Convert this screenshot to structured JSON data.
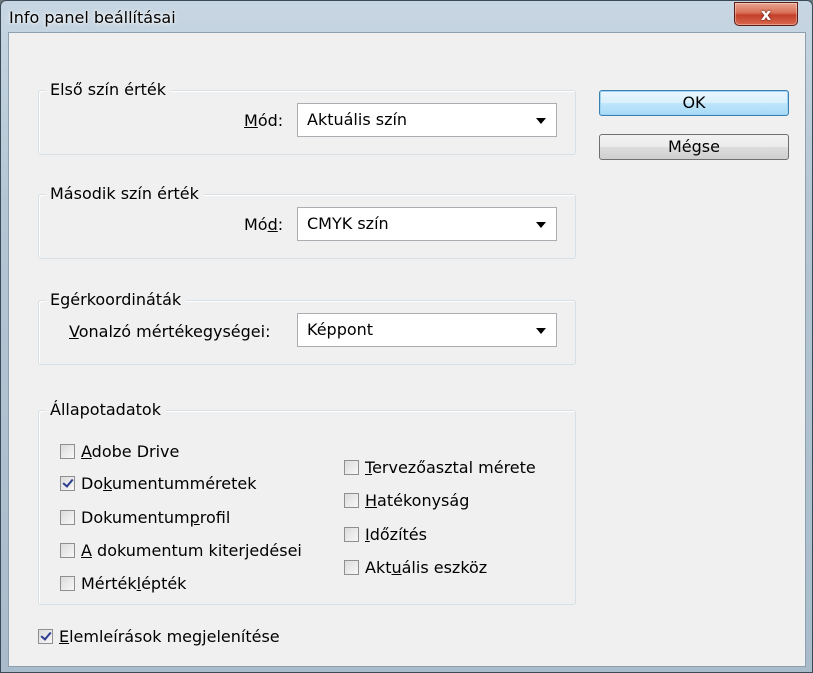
{
  "window": {
    "title": "Info panel beállításai",
    "close_glyph": "x"
  },
  "buttons": {
    "ok": "OK",
    "cancel": "Mégse"
  },
  "first_color": {
    "title": "Első szín érték",
    "mode_label_pre": "",
    "mode_label_u": "M",
    "mode_label_post": "ód:",
    "mode_value": "Aktuális szín"
  },
  "second_color": {
    "title": "Második szín érték",
    "mode_label_pre": "Mó",
    "mode_label_u": "d",
    "mode_label_post": ":",
    "mode_value": "CMYK szín"
  },
  "mouse": {
    "title": "Egérkoordináták",
    "ruler_label_pre": "",
    "ruler_label_u": "V",
    "ruler_label_post": "onalzó mértékegységei:",
    "ruler_value": "Képpont"
  },
  "status": {
    "title": "Állapotadatok",
    "left": [
      {
        "pre": "",
        "u": "A",
        "post": "dobe Drive",
        "checked": false
      },
      {
        "pre": "Do",
        "u": "k",
        "post": "umentumméretek",
        "checked": true
      },
      {
        "pre": "Dokumentum",
        "u": "p",
        "post": "rofil",
        "checked": false
      },
      {
        "pre": "",
        "u": "A",
        "post": " dokumentum kiterjedései",
        "checked": false
      },
      {
        "pre": "Mérték",
        "u": "l",
        "post": "épték",
        "checked": false
      }
    ],
    "right": [
      {
        "pre": "",
        "u": "T",
        "post": "ervezőasztal mérete",
        "checked": false
      },
      {
        "pre": "",
        "u": "H",
        "post": "atékonyság",
        "checked": false
      },
      {
        "pre": "",
        "u": "I",
        "post": "dőzítés",
        "checked": false
      },
      {
        "pre": "Akt",
        "u": "u",
        "post": "ális eszköz",
        "checked": false
      }
    ]
  },
  "tooltips": {
    "pre": "",
    "u": "E",
    "post": "lemleírások megjelenítése",
    "checked": true
  }
}
